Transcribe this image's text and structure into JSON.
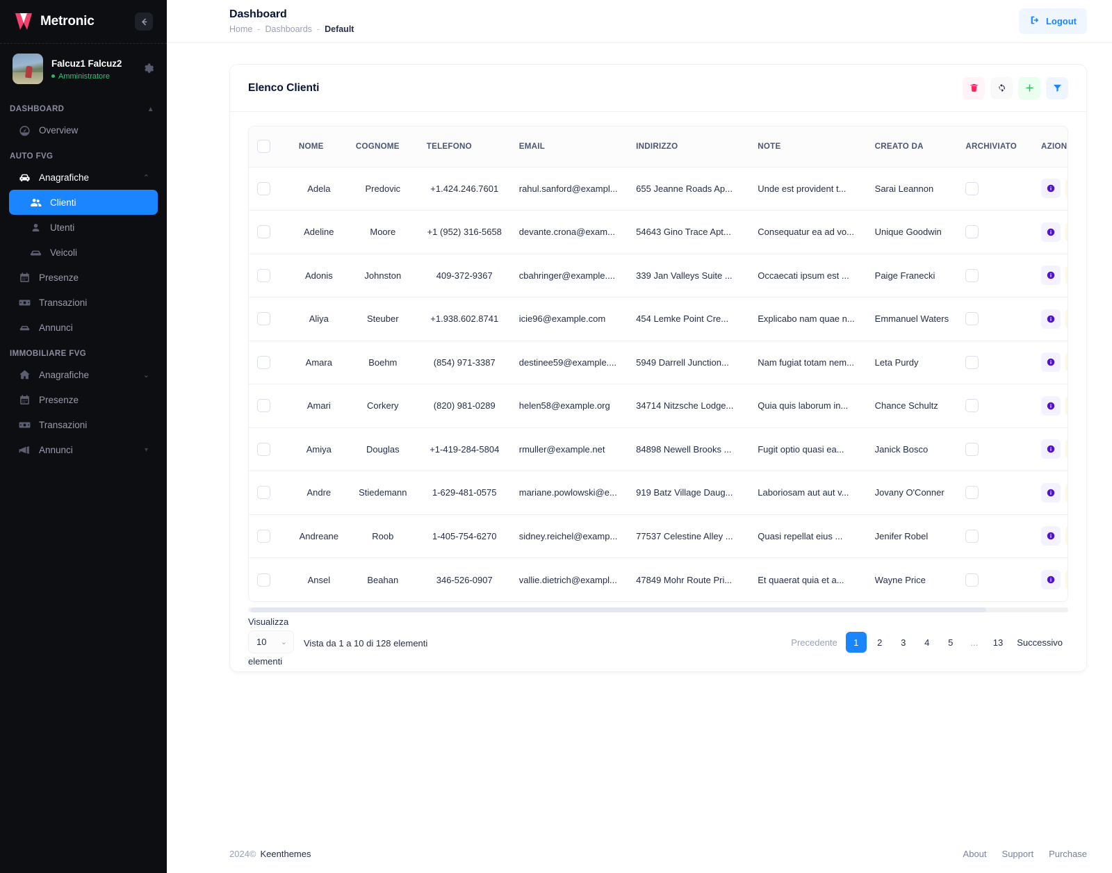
{
  "sidebar": {
    "brand": "Metronic",
    "collapse_icon": "arrow-left-icon",
    "user": {
      "name": "Falcuz1 Falcuz2",
      "role": "Amministratore"
    },
    "sections": [
      {
        "label": "DASHBOARD",
        "items": [
          {
            "label": "Overview",
            "icon": "gauge-icon",
            "state": "normal"
          }
        ]
      },
      {
        "label": "AUTO FVG",
        "items": [
          {
            "label": "Anagrafiche",
            "icon": "car-icon",
            "state": "open",
            "arrow": "chevron-up"
          },
          {
            "label": "Clienti",
            "icon": "users-icon",
            "state": "active",
            "sub": true
          },
          {
            "label": "Utenti",
            "icon": "user-icon",
            "state": "normal",
            "sub": true
          },
          {
            "label": "Veicoli",
            "icon": "car-side-icon",
            "state": "normal",
            "sub": true
          },
          {
            "label": "Presenze",
            "icon": "calendar-icon",
            "state": "normal"
          },
          {
            "label": "Transazioni",
            "icon": "banknote-icon",
            "state": "normal"
          },
          {
            "label": "Annunci",
            "icon": "megaphone-icon",
            "state": "normal"
          }
        ]
      },
      {
        "label": "IMMOBILIARE FVG",
        "items": [
          {
            "label": "Anagrafiche",
            "icon": "home-icon",
            "state": "normal",
            "arrow": "chevron-down"
          },
          {
            "label": "Presenze",
            "icon": "calendar-icon",
            "state": "normal"
          },
          {
            "label": "Transazioni",
            "icon": "banknote-icon",
            "state": "normal"
          },
          {
            "label": "Annunci",
            "icon": "megaphone-icon",
            "state": "normal"
          }
        ]
      }
    ]
  },
  "topbar": {
    "title": "Dashboard",
    "breadcrumbs": [
      "Home",
      "Dashboards",
      "Default"
    ],
    "separator": "-",
    "logout_label": "Logout"
  },
  "card": {
    "title": "Elenco Clienti",
    "tools": [
      {
        "name": "delete-selected-button",
        "icon": "trash-icon",
        "style": "danger"
      },
      {
        "name": "refresh-button",
        "icon": "refresh-icon",
        "style": "neutral"
      },
      {
        "name": "add-button",
        "icon": "plus-icon",
        "style": "success"
      },
      {
        "name": "filter-button",
        "icon": "filter-icon",
        "style": "info"
      }
    ]
  },
  "table": {
    "columns": [
      "",
      "NOME",
      "COGNOME",
      "TELEFONO",
      "EMAIL",
      "INDIRIZZO",
      "NOTE",
      "CREATO DA",
      "ARCHIVIATO",
      "AZIONI"
    ],
    "rows": [
      {
        "nome": "Adela",
        "cognome": "Predovic",
        "telefono": "+1.424.246.7601",
        "email": "rahul.sanford@exampl...",
        "indirizzo": "655 Jeanne Roads Ap...",
        "note": "Unde est provident t...",
        "creato_da": "Sarai Leannon"
      },
      {
        "nome": "Adeline",
        "cognome": "Moore",
        "telefono": "+1 (952) 316-5658",
        "email": "devante.crona@exam...",
        "indirizzo": "54643 Gino Trace Apt...",
        "note": "Consequatur ea ad vo...",
        "creato_da": "Unique Goodwin"
      },
      {
        "nome": "Adonis",
        "cognome": "Johnston",
        "telefono": "409-372-9367",
        "email": "cbahringer@example....",
        "indirizzo": "339 Jan Valleys Suite ...",
        "note": "Occaecati ipsum est ...",
        "creato_da": "Paige Franecki"
      },
      {
        "nome": "Aliya",
        "cognome": "Steuber",
        "telefono": "+1.938.602.8741",
        "email": "icie96@example.com",
        "indirizzo": "454 Lemke Point Cre...",
        "note": "Explicabo nam quae n...",
        "creato_da": "Emmanuel Waters"
      },
      {
        "nome": "Amara",
        "cognome": "Boehm",
        "telefono": "(854) 971-3387",
        "email": "destinee59@example....",
        "indirizzo": "5949 Darrell Junction...",
        "note": "Nam fugiat totam nem...",
        "creato_da": "Leta Purdy"
      },
      {
        "nome": "Amari",
        "cognome": "Corkery",
        "telefono": "(820) 981-0289",
        "email": "helen58@example.org",
        "indirizzo": "34714 Nitzsche Lodge...",
        "note": "Quia quis laborum in...",
        "creato_da": "Chance Schultz"
      },
      {
        "nome": "Amiya",
        "cognome": "Douglas",
        "telefono": "+1-419-284-5804",
        "email": "rmuller@example.net",
        "indirizzo": "84898 Newell Brooks ...",
        "note": "Fugit optio quasi ea...",
        "creato_da": "Janick Bosco"
      },
      {
        "nome": "Andre",
        "cognome": "Stiedemann",
        "telefono": "1-629-481-0575",
        "email": "mariane.powlowski@e...",
        "indirizzo": "919 Batz Village Daug...",
        "note": "Laboriosam aut aut v...",
        "creato_da": "Jovany O'Conner"
      },
      {
        "nome": "Andreane",
        "cognome": "Roob",
        "telefono": "1-405-754-6270",
        "email": "sidney.reichel@examp...",
        "indirizzo": "77537 Celestine Alley ...",
        "note": "Quasi repellat eius ...",
        "creato_da": "Jenifer Robel"
      },
      {
        "nome": "Ansel",
        "cognome": "Beahan",
        "telefono": "346-526-0907",
        "email": "vallie.dietrich@exampl...",
        "indirizzo": "47849 Mohr Route Pri...",
        "note": "Et quaerat quia et a...",
        "creato_da": "Wayne Price"
      }
    ],
    "row_actions": [
      {
        "name": "view-row-button",
        "icon": "info-icon"
      },
      {
        "name": "edit-row-button",
        "icon": "pencil-square-icon"
      },
      {
        "name": "delete-row-button",
        "icon": "trash-icon"
      }
    ]
  },
  "footer_bar": {
    "length_label": "Visualizza",
    "length_after": "elementi",
    "length_value": "10",
    "info": "Vista da 1 a 10 di 128 elementi",
    "pagination": {
      "prev": "Precedente",
      "next": "Successivo",
      "pages": [
        "1",
        "2",
        "3",
        "4",
        "5",
        "...",
        "13"
      ],
      "active": "1"
    }
  },
  "page_footer": {
    "year": "2024©",
    "company": "Keenthemes",
    "links": [
      "About",
      "Support",
      "Purchase"
    ]
  },
  "colors": {
    "primary": "#1b84ff",
    "danger": "#f8285a",
    "success": "#17c653",
    "warning": "#f6b100",
    "purple": "#5014d0",
    "sidebar_bg": "#0d0e12"
  }
}
